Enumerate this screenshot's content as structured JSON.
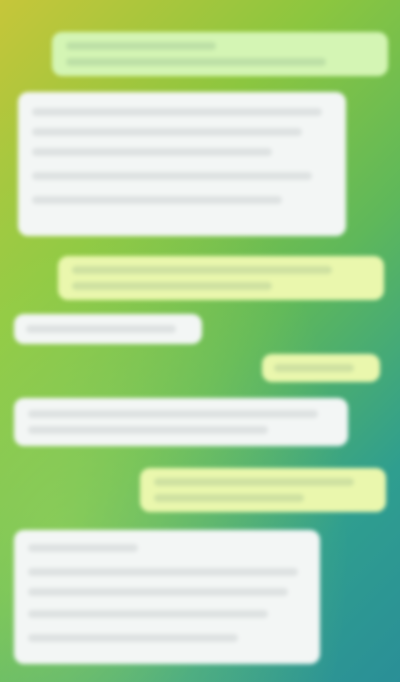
{
  "chat": {
    "messages": [
      {
        "id": "m1",
        "direction": "outgoing",
        "text": ""
      },
      {
        "id": "m2",
        "direction": "incoming",
        "text": ""
      },
      {
        "id": "m3",
        "direction": "outgoing",
        "text": ""
      },
      {
        "id": "m4",
        "direction": "incoming",
        "text": ""
      },
      {
        "id": "m5",
        "direction": "outgoing",
        "text": ""
      },
      {
        "id": "m6",
        "direction": "incoming",
        "text": ""
      },
      {
        "id": "m7",
        "direction": "outgoing",
        "text": ""
      },
      {
        "id": "m8",
        "direction": "incoming",
        "text": ""
      }
    ]
  },
  "colors": {
    "outgoing_bubble": "#d4f5b4",
    "outgoing_bubble_alt": "#eaf7ad",
    "incoming_bubble": "#f3f6f5",
    "background_start": "#c6c63a",
    "background_end": "#2a8f97"
  }
}
